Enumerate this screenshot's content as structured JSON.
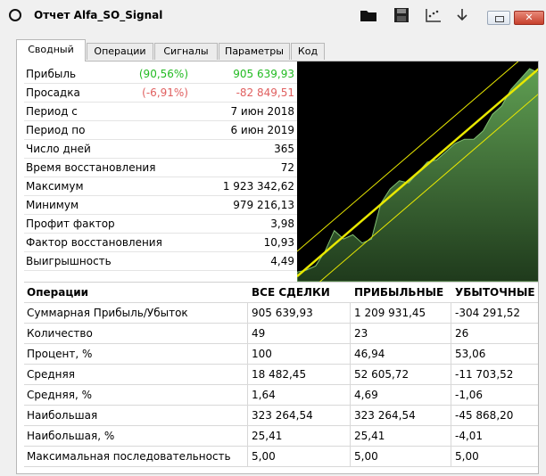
{
  "window": {
    "title": "Отчет Alfa_SO_Signal"
  },
  "tabs": [
    {
      "label": "Сводный",
      "active": true
    },
    {
      "label": "Операции"
    },
    {
      "label": "Сигналы"
    },
    {
      "label": "Параметры"
    },
    {
      "label": "Код"
    }
  ],
  "colors": {
    "positive": "#22bb22",
    "negative": "#e06060",
    "chart_bg": "#000000",
    "equity": "#5a9a4a",
    "channel": "#e8e800"
  },
  "stats": [
    {
      "label": "Прибыль",
      "pct": "(90,56%)",
      "value": "905 639,93",
      "tone": "pos"
    },
    {
      "label": "Просадка",
      "pct": "(-6,91%)",
      "value": "-82 849,51",
      "tone": "neg"
    },
    {
      "label": "Период с",
      "value": "7 июн 2018"
    },
    {
      "label": "Период по",
      "value": "6 июн 2019"
    },
    {
      "label": "Число дней",
      "value": "365"
    },
    {
      "label": "Время восстановления",
      "value": "72"
    },
    {
      "label": "Максимум",
      "value": "1 923 342,62"
    },
    {
      "label": "Минимум",
      "value": "979 216,13"
    },
    {
      "label": "Профит фактор",
      "value": "3,98"
    },
    {
      "label": "Фактор восстановления",
      "value": "10,93"
    },
    {
      "label": "Выигрышность",
      "value": "4,49"
    }
  ],
  "operations": {
    "headers": [
      "Операции",
      "ВСЕ СДЕЛКИ",
      "ПРИБЫЛЬНЫЕ",
      "УБЫТОЧНЫЕ"
    ],
    "rows": [
      [
        "Суммарная Прибыль/Убыток",
        "905 639,93",
        "1 209 931,45",
        "-304 291,52"
      ],
      [
        "Количество",
        "49",
        "23",
        "26"
      ],
      [
        "Процент, %",
        "100",
        "46,94",
        "53,06"
      ],
      [
        "Средняя",
        "18 482,45",
        "52 605,72",
        "-11 703,52"
      ],
      [
        "Средняя, %",
        "1,64",
        "4,69",
        "-1,06"
      ],
      [
        "Наибольшая",
        "323 264,54",
        "323 264,54",
        "-45 868,20"
      ],
      [
        "Наибольшая, %",
        "25,41",
        "25,41",
        "-4,01"
      ],
      [
        "Максимальная последовательность",
        "5,00",
        "5,00",
        "5,00"
      ]
    ]
  },
  "chart_data": {
    "type": "area",
    "equity": [
      0.02,
      0.03,
      0.05,
      0.12,
      0.22,
      0.18,
      0.2,
      0.16,
      0.18,
      0.35,
      0.42,
      0.46,
      0.45,
      0.5,
      0.55,
      0.56,
      0.6,
      0.64,
      0.66,
      0.66,
      0.7,
      0.78,
      0.82,
      0.9,
      0.95,
      1.0,
      0.98
    ],
    "regression": [
      0.0,
      1.0
    ]
  }
}
